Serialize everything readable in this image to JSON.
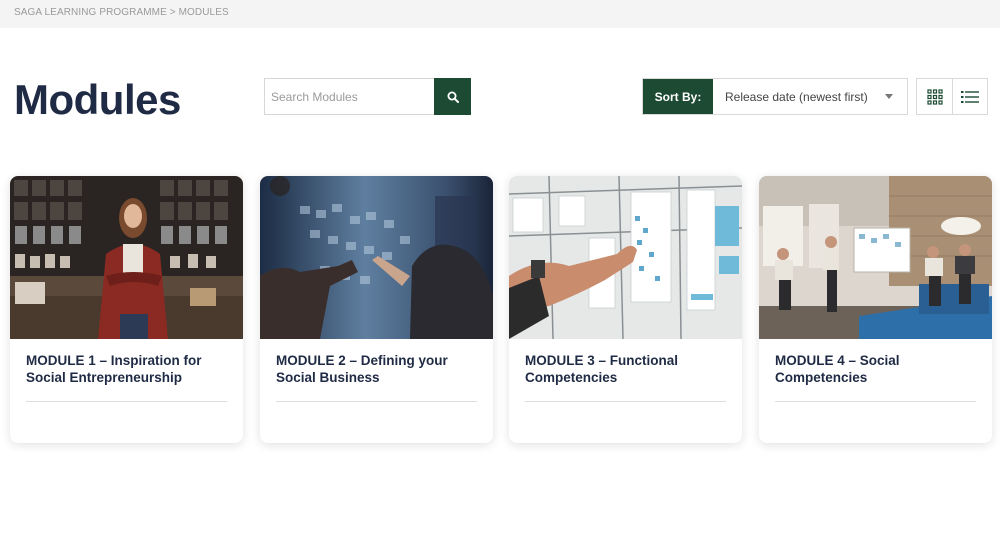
{
  "breadcrumb": {
    "root": "SAGA LEARNING PROGRAMME",
    "separator": " > ",
    "current": "MODULES"
  },
  "page": {
    "title": "Modules"
  },
  "search": {
    "placeholder": "Search Modules",
    "value": "",
    "icon": "search-icon"
  },
  "sort": {
    "label": "Sort By:",
    "selected": "Release date (newest first)"
  },
  "view_toggle": {
    "grid_icon": "grid-icon",
    "list_icon": "list-icon",
    "active": "grid"
  },
  "colors": {
    "accent": "#1c4a32",
    "title": "#1f2a44",
    "breadcrumb_bg": "#f4f4f4"
  },
  "modules": [
    {
      "title": "MODULE 1 – Inspiration for Social Entrepreneurship"
    },
    {
      "title": "MODULE 2 – Defining your Social Business"
    },
    {
      "title": "MODULE 3 – Functional Competencies"
    },
    {
      "title": "MODULE 4 – Social Competencies"
    }
  ]
}
